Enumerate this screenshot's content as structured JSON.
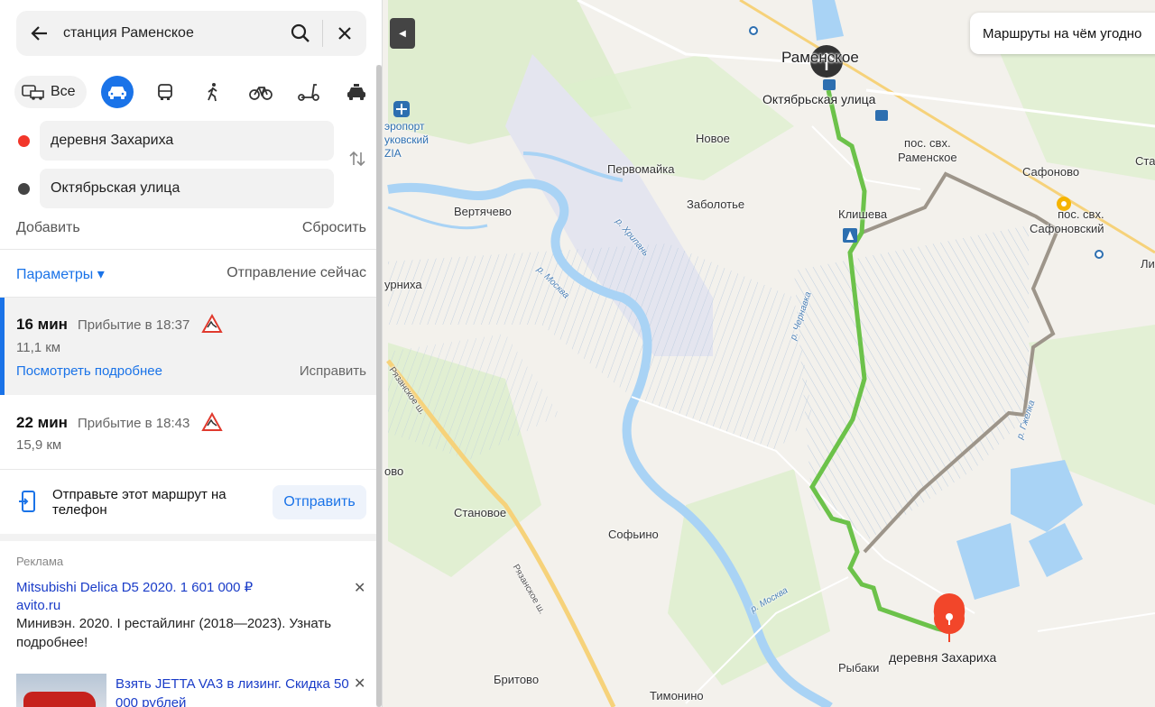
{
  "search": {
    "query": "станция Раменское"
  },
  "modes": {
    "all_label": "Все"
  },
  "points": {
    "from": "деревня Захариха",
    "to": "Октябрьская улица"
  },
  "actions": {
    "add": "Добавить",
    "reset": "Сбросить"
  },
  "params": {
    "label": "Параметры ▾",
    "departure": "Отправление сейчас"
  },
  "routes": [
    {
      "time": "16 мин",
      "arrival": "Прибытие в 18:37",
      "distance": "11,1 км",
      "details": "Посмотреть подробнее",
      "fix": "Исправить"
    },
    {
      "time": "22 мин",
      "arrival": "Прибытие в 18:43",
      "distance": "15,9 км"
    }
  ],
  "send": {
    "text": "Отправьте этот маршрут на телефон",
    "button": "Отправить"
  },
  "ads": {
    "label": "Реклама",
    "ad1": {
      "title": "Mitsubishi Delica D5 2020. 1 601 000 ₽",
      "site": "avito.ru",
      "desc": "Минивэн. 2020. I рестайлинг (2018—2023). Узнать подробнее!"
    },
    "ad2": {
      "title": "Взять JETTA VA3 в лизинг. Скидка 50 000 рублей"
    }
  },
  "promo": "Маршруты на чём угодно",
  "map_labels": {
    "ramenskoe": "Раменское",
    "oktyabrskaya": "Октябрьская улица",
    "airport": "эропорт\nуковский\nZIA",
    "novoe": "Новое",
    "pervomaika": "Первомайка",
    "zabolotye": "Заболотье",
    "vertyachevo": "Вертячево",
    "klishevo": "Клишева",
    "pos_ramenskoe": "пос. свх.\nРаменское",
    "safonovo": "Сафоново",
    "pos_safonovsky": "пос. свх.\nСафоновский",
    "sta": "Ста",
    "li": "Ли",
    "urnikha": "урниха",
    "ovo": "ово",
    "stanovoe": "Становое",
    "sofino": "Софьино",
    "britovo": "Бритово",
    "timonino": "Тимонино",
    "rybaki": "Рыбаки",
    "zakharikha": "деревня Захариха",
    "river_moskva1": "р. Москва",
    "river_moskva2": "р. Москва",
    "river_khrapan": "р. Хрипань",
    "river_chernavka": "р. Чернавка",
    "river_gzhelka": "р. Гжелка",
    "road_ryazan1": "Рязанское ш.",
    "road_ryazan2": "Рязанское ш."
  },
  "colors": {
    "accent": "#1a73e8",
    "route_main": "#6cc24a",
    "route_alt": "#9d958a",
    "water": "#a9d3f5",
    "pin": "#f2462a"
  }
}
